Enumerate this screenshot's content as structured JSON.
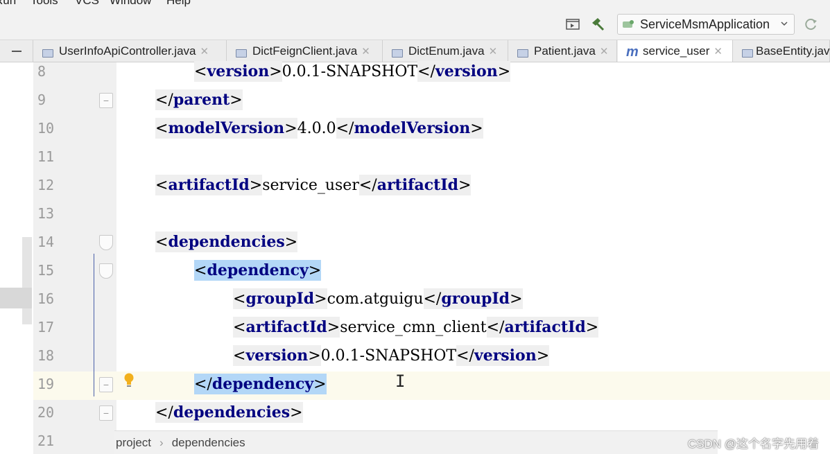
{
  "menubar": {
    "items": [
      {
        "label": "Run"
      },
      {
        "label": "Tools"
      },
      {
        "label": "VCS"
      },
      {
        "label": "Window"
      },
      {
        "label": "Help"
      }
    ]
  },
  "toolbar": {
    "icons": [
      "run-window-icon",
      "hammer-icon",
      "vcs-update-icon"
    ],
    "run_config_label": "ServiceMsmApplication"
  },
  "tabs": [
    {
      "label": "UserInfoApiController.java",
      "icon": "java-class-icon",
      "active": false
    },
    {
      "label": "DictFeignClient.java",
      "icon": "java-class-icon",
      "active": false
    },
    {
      "label": "DictEnum.java",
      "icon": "java-class-icon",
      "active": false
    },
    {
      "label": "Patient.java",
      "icon": "java-class-icon",
      "active": false
    },
    {
      "label": "service_user",
      "icon": "maven-icon",
      "active": true
    },
    {
      "label": "BaseEntity.java",
      "icon": "java-class-icon",
      "active": false
    }
  ],
  "editor": {
    "lines": [
      {
        "num": "8",
        "tag": "version",
        "value": "0.0.1-SNAPSHOT"
      },
      {
        "num": "9",
        "close": "parent"
      },
      {
        "num": "10",
        "tag": "modelVersion",
        "value": "4.0.0"
      },
      {
        "num": "11"
      },
      {
        "num": "12",
        "tag": "artifactId",
        "value": "service_user"
      },
      {
        "num": "13"
      },
      {
        "num": "14",
        "open": "dependencies"
      },
      {
        "num": "15",
        "open": "dependency"
      },
      {
        "num": "16",
        "tag": "groupId",
        "value": "com.atguigu"
      },
      {
        "num": "17",
        "tag": "artifactId",
        "value": "service_cmn_client"
      },
      {
        "num": "18",
        "tag": "version",
        "value": "0.0.1-SNAPSHOT"
      },
      {
        "num": "19",
        "close": "dependency"
      },
      {
        "num": "20",
        "close": "dependencies"
      },
      {
        "num": "21"
      }
    ],
    "current_line": "19"
  },
  "breadcrumb": {
    "items": [
      "project",
      "dependencies"
    ]
  },
  "watermark": "CSDN @这个名字先用着",
  "colors": {
    "tag_name": "#000080",
    "tag_highlight": "#b3d7f7",
    "current_line": "#fcfaed",
    "gutter": "#f0f0f0"
  }
}
